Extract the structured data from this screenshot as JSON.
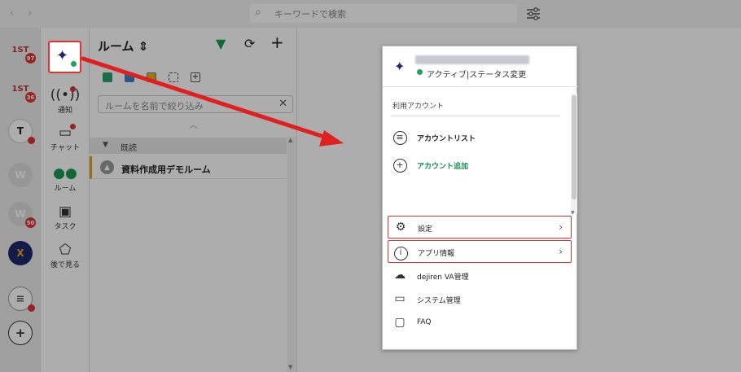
{
  "topbar": {
    "search_placeholder": "キーワードで検索"
  },
  "accounts": [
    {
      "label": "1ST",
      "badge": "97",
      "bg": "#ffffff",
      "fg": "#c0392b"
    },
    {
      "label": "1ST",
      "badge": "36",
      "bg": "#ffffff",
      "fg": "#c0392b"
    },
    {
      "label": "T",
      "badge": "",
      "bg": "#ffffff",
      "fg": "#333333"
    },
    {
      "label": "W",
      "badge": "",
      "bg": "#dddddd",
      "fg": "#ffffff"
    },
    {
      "label": "W",
      "badge": "50",
      "bg": "#dddddd",
      "fg": "#ffffff"
    },
    {
      "label": "X",
      "badge": "",
      "bg": "#1c2a6b",
      "fg": "#e8a020"
    }
  ],
  "nav": {
    "notify": "通知",
    "chat": "チャット",
    "room": "ルーム",
    "task": "タスク",
    "later": "後で見る"
  },
  "rooms": {
    "title": "ルーム",
    "search_placeholder": "ルームを名前で絞り込み",
    "section_label": "既読",
    "room_name": "資料作成用デモルーム"
  },
  "menu": {
    "status": "アクティブ|ステータス変更",
    "section": "利用アカウント",
    "account_list": "アカウントリスト",
    "add_account": "アカウント追加",
    "settings": "設定",
    "app_info": "アプリ情報",
    "dejiren_va": "dejiren VA管理",
    "system": "システム管理",
    "faq": "FAQ"
  },
  "colors": {
    "accent_red": "#d33333",
    "online_green": "#1fa35c",
    "add_green": "#1a8c4e",
    "filter_green": "#1a9a50"
  }
}
